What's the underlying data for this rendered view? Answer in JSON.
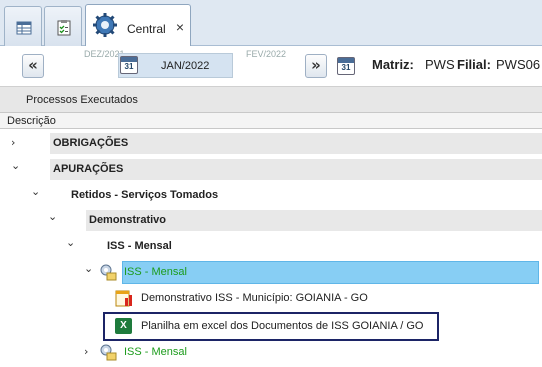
{
  "tabs": [
    {
      "name": "grid-tab",
      "icon": "grid-icon"
    },
    {
      "name": "checklist-tab",
      "icon": "checklist-icon"
    },
    {
      "name": "central-tab",
      "icon": "gear-icon",
      "label": "Central",
      "close": "×"
    }
  ],
  "toolbar": {
    "prev_button": "«",
    "next_button": "»",
    "month_prev": "DEZ/2021",
    "month_current": "JAN/2022",
    "month_next": "FEV/2022",
    "calendar_icon_text": "31",
    "matriz_label": "Matriz:",
    "matriz_value": "PWS",
    "filial_label": "Filial:",
    "filial_value": "PWS06"
  },
  "group_header": "Processos Executados",
  "column_header": "Descrição",
  "tree": {
    "obrigacoes": {
      "label": "OBRIGAÇÕES",
      "chevron": "›"
    },
    "apuracoes": {
      "label": "APURAÇÕES",
      "chevron": "⌄"
    },
    "retidos": {
      "label": "Retidos - Serviços Tomados",
      "chevron": "⌄"
    },
    "demonstrativo": {
      "label": "Demonstrativo",
      "chevron": "⌄"
    },
    "iss_mensal_group": {
      "label": "ISS - Mensal",
      "chevron": "⌄"
    },
    "iss_mensal_selected": {
      "label": "ISS - Mensal",
      "chevron": "⌄"
    },
    "report_item": {
      "label": "Demonstrativo ISS - Município: GOIANIA - GO"
    },
    "excel_item": {
      "label": "Planilha em excel dos Documentos de ISS GOIANIA / GO",
      "icon_text": "X"
    },
    "iss_mensal_collapsed": {
      "label": "ISS - Mensal",
      "chevron": "›"
    }
  },
  "colors": {
    "selected": "#87cef4",
    "green_text": "#1c9b1c",
    "highlight_border": "#1c2466"
  }
}
